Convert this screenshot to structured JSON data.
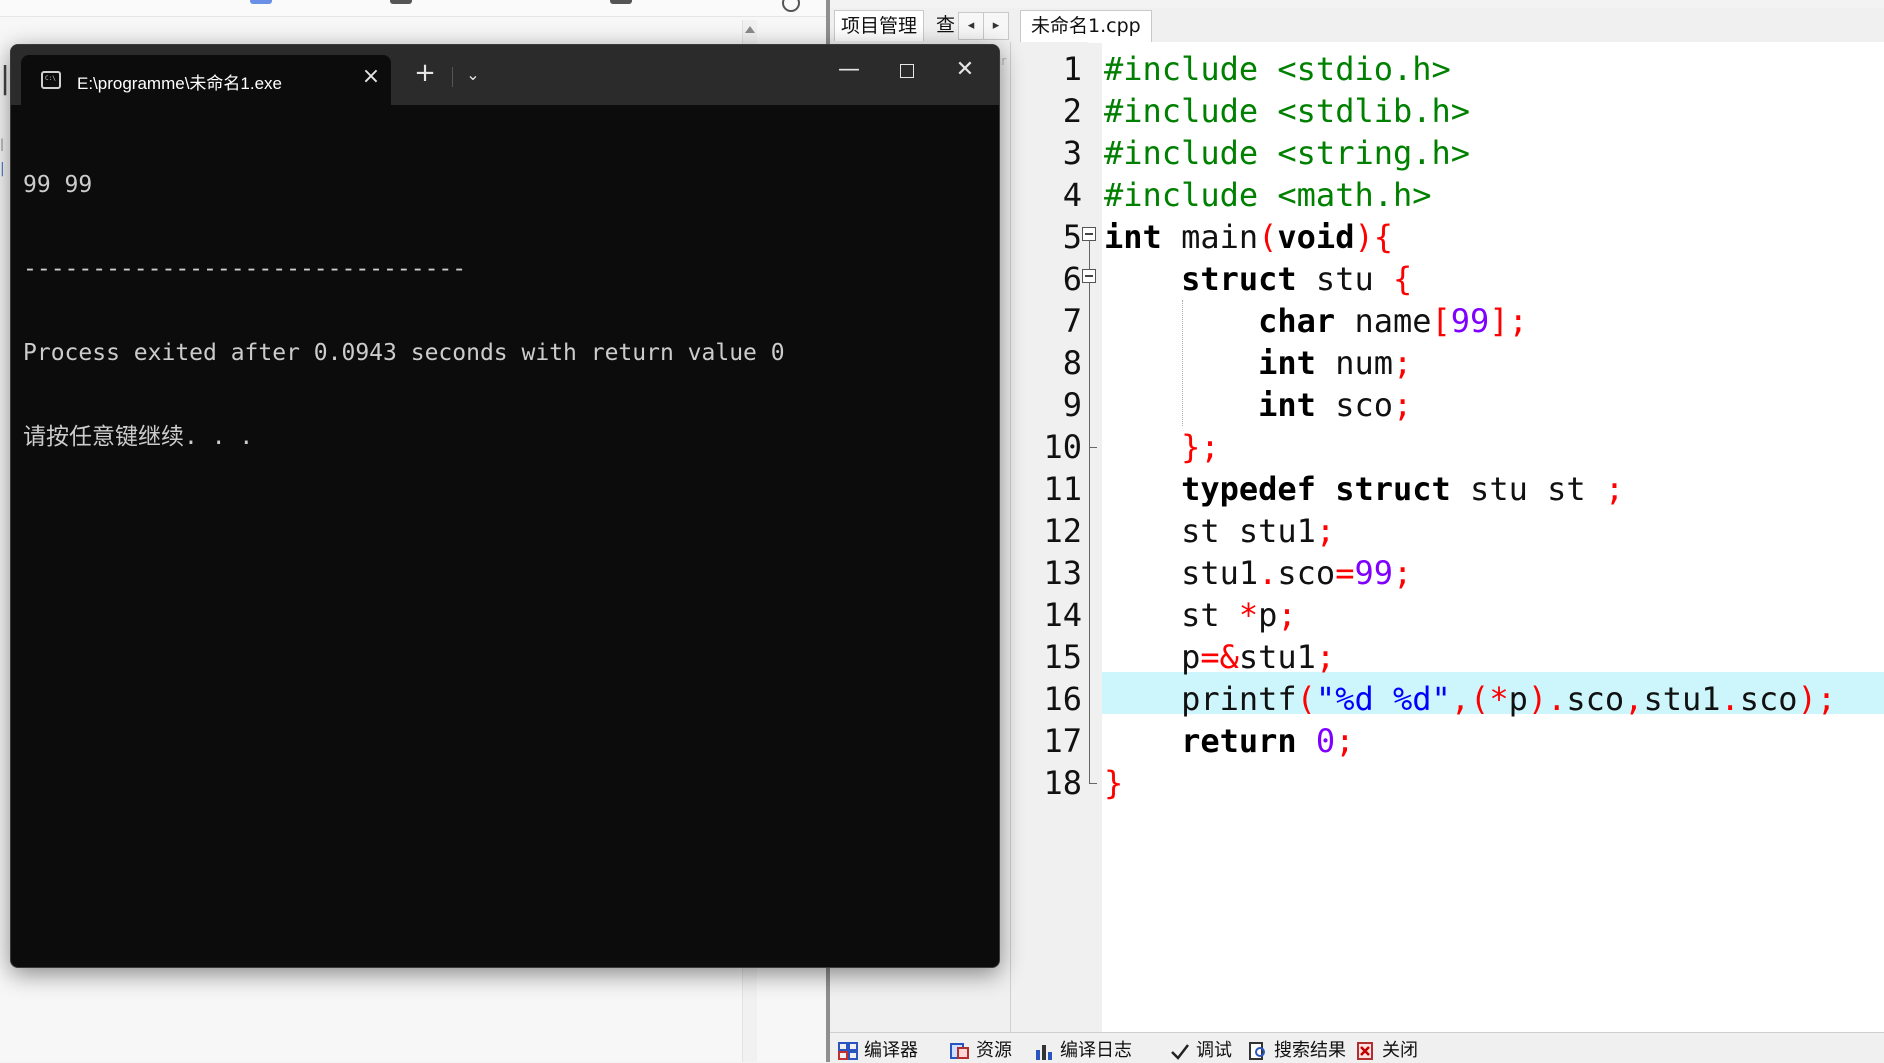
{
  "terminal": {
    "title": "E:\\programme\\未命名1.exe",
    "output_lines": [
      "99 99",
      "--------------------------------",
      "Process exited after 0.0943 seconds with return value 0",
      "请按任意键继续. . ."
    ],
    "icons": {
      "app": "terminal-app-icon",
      "close_tab": "close-icon",
      "new_tab": "plus-icon",
      "dropdown": "chevron-down-icon",
      "minimize": "minimize-icon",
      "maximize": "maximize-icon",
      "close_window": "close-icon"
    }
  },
  "ide": {
    "panel_tabs": [
      "项目管理",
      "查"
    ],
    "file_tab": "未命名1.cpp",
    "highlight_line": 16,
    "line_numbers": [
      "1",
      "2",
      "3",
      "4",
      "5",
      "6",
      "7",
      "8",
      "9",
      "10",
      "11",
      "12",
      "13",
      "14",
      "15",
      "16",
      "17",
      "18"
    ],
    "code_lines": [
      "#include <stdio.h>",
      "#include <stdlib.h>",
      "#include <string.h>",
      "#include <math.h>",
      "int main(void){",
      "    struct stu {",
      "        char name[99];",
      "        int num;",
      "        int sco;",
      "    };",
      "    typedef struct stu st ;",
      "    st stu1;",
      "    stu1.sco=99;",
      "    st *p;",
      "    p=&stu1;",
      "    printf(\"%d %d\",(*p).sco,stu1.sco);",
      "    return 0;",
      "}"
    ],
    "bottom_tabs": [
      "编译器",
      "资源",
      "编译日志",
      "调试",
      "搜索结果",
      "关闭"
    ],
    "colors": {
      "preprocessor": "#008000",
      "symbol": "#ff0000",
      "number": "#8000ff",
      "string": "#0000ff",
      "highlight": "#ccf6fc"
    }
  }
}
